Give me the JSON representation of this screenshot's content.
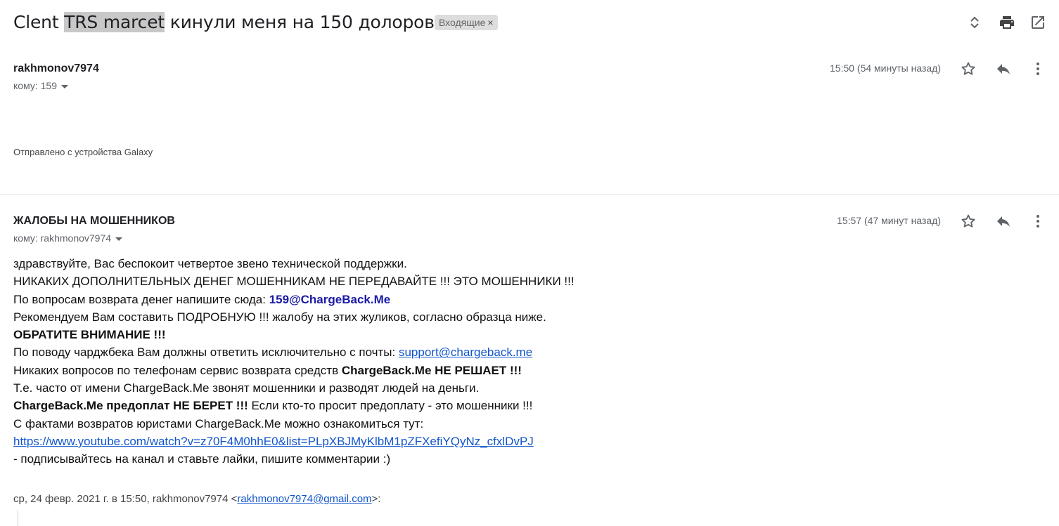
{
  "subject": {
    "prefix": "Clent ",
    "highlight": "TRS marcet",
    "suffix": " кинули меня на 150 долоров",
    "label": "Входящие",
    "label_remove": "×"
  },
  "top_actions": {
    "icons": [
      "expand-collapse-icon",
      "print-icon",
      "open-in-new-window-icon"
    ]
  },
  "messages": [
    {
      "sender": "rakhmonov7974",
      "to": "кому: 159",
      "time": "15:50 (54 минуты назад)",
      "signature": "Отправлено с устройства Galaxy"
    },
    {
      "sender": "ЖАЛОБЫ НА МОШЕННИКОВ",
      "to": "кому: rakhmonov7974",
      "time": "15:57 (47 минут назад)",
      "body": {
        "l1": "здравствуйте, Вас беспокоит четвертое звено технической поддержки.",
        "l2": "НИКАКИХ ДОПОЛНИТЕЛЬНЫХ ДЕНЕГ МОШЕННИКАМ НЕ ПЕРЕДАВАЙТЕ !!! ЭТО МОШЕННИКИ !!!",
        "l3_text": "По вопросам возврата денег напишите сюда: ",
        "l3_email": "159@ChargeBack.Me",
        "l4": "Рекомендуем Вам составить ПОДРОБНУЮ !!! жалобу на этих жуликов, согласно образца ниже.",
        "l5": "ОБРАТИТЕ ВНИМАНИЕ !!!",
        "l6_text": "По поводу чарджбека Вам должны ответить исключительно с почты: ",
        "l6_link": "support@chargeback.me",
        "l7_text": "Никаких вопросов по телефонам сервис возврата средств ",
        "l7_bold": "ChargeBack.Me НЕ РЕШАЕТ !!!",
        "l8": "Т.е. часто от имени ChargeBack.Me звонят мошенники и разводят людей на деньги.",
        "l9_bold": "ChargeBack.Me предоплат НЕ БЕРЕТ !!!",
        "l9_text": " Если кто-то просит предоплату - это мошенники !!!",
        "l10": "С фактами возвратов юристами ChargeBack.Me можно ознакомиться тут:",
        "l11_link": "https://www.youtube.com/watch?v=z70F4M0hhE0&list=PLpXBJMyKlbM1pZFXefiYQyNz_cfxlDvPJ",
        "l12": " - подписывайтесь на канал и ставьте лайки, пишите комментарии :)"
      },
      "quote": {
        "prefix": "ср, 24 февр. 2021 г. в 15:50, rakhmonov7974 <",
        "email": "rakhmonov7974@gmail.com",
        "suffix": ">:"
      }
    }
  ]
}
